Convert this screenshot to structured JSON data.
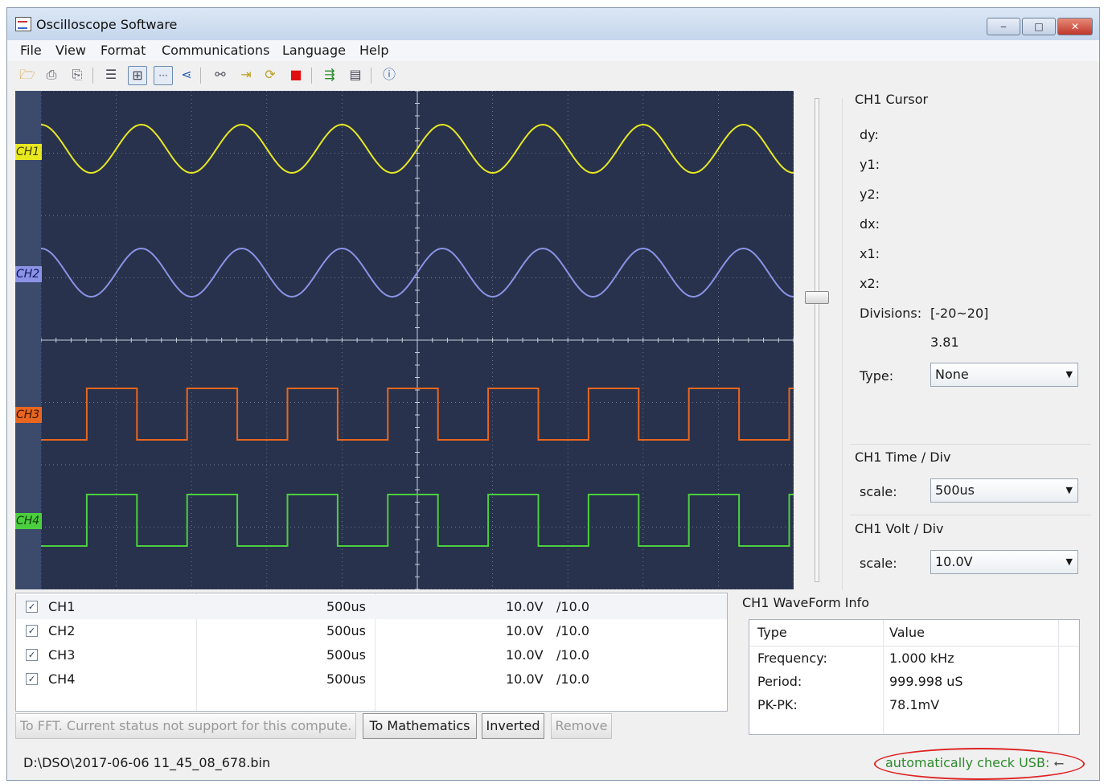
{
  "window": {
    "title": "Oscilloscope Software",
    "controls": {
      "minimize": "‒",
      "maximize": "□",
      "close": "✕"
    }
  },
  "menu": [
    "File",
    "View",
    "Format",
    "Communications",
    "Language",
    "Help"
  ],
  "toolbar_icons": [
    "open-icon",
    "print-icon",
    "print-preview-icon",
    "list-icon",
    "grid-icon",
    "dots-icon",
    "cursor-icon",
    "connect-icon",
    "import-icon",
    "run-icon",
    "stop-icon",
    "export-icon",
    "display-icon",
    "help-icon"
  ],
  "scope": {
    "labels": [
      "CH1",
      "CH2",
      "CH3",
      "CH4"
    ],
    "colors": {
      "ch1": "#e8e821",
      "ch2": "#8a93e6",
      "ch3": "#e8661f",
      "ch4": "#4ccf3e",
      "background": "#28324c",
      "grid": "#8892a8"
    },
    "waveforms": [
      {
        "channel": "CH1",
        "shape": "sine",
        "cycles": 7.5
      },
      {
        "channel": "CH2",
        "shape": "sine",
        "cycles": 7.5
      },
      {
        "channel": "CH3",
        "shape": "square",
        "cycles": 7.5
      },
      {
        "channel": "CH4",
        "shape": "square",
        "cycles": 7.5
      }
    ]
  },
  "cursor": {
    "title": "CH1 Cursor",
    "dy": "dy:",
    "y1": "y1:",
    "y2": "y2:",
    "dx": "dx:",
    "x1": "x1:",
    "x2": "x2:",
    "divisions_label": "Divisions:",
    "divisions_range": "[-20~20]",
    "divisions_value": "3.81",
    "type_label": "Type:",
    "type_value": "None"
  },
  "time_div": {
    "title": "CH1 Time / Div",
    "scale_label": "scale:",
    "value": "500us"
  },
  "volt_div": {
    "title": "CH1 Volt / Div",
    "scale_label": "scale:",
    "value": "10.0V"
  },
  "channels": [
    {
      "name": "CH1",
      "time": "500us",
      "volt": "10.0V",
      "probe": "/10.0"
    },
    {
      "name": "CH2",
      "time": "500us",
      "volt": "10.0V",
      "probe": "/10.0"
    },
    {
      "name": "CH3",
      "time": "500us",
      "volt": "10.0V",
      "probe": "/10.0"
    },
    {
      "name": "CH4",
      "time": "500us",
      "volt": "10.0V",
      "probe": "/10.0"
    }
  ],
  "buttons": {
    "fft": "To FFT. Current status not support for this compute.",
    "math": "To Mathematics",
    "inverted": "Inverted",
    "remove": "Remove"
  },
  "waveform_info": {
    "title": "CH1 WaveForm Info",
    "headers": [
      "Type",
      "Value"
    ],
    "rows": [
      {
        "type": "Frequency:",
        "value": "1.000 kHz"
      },
      {
        "type": "Period:",
        "value": "999.998 uS"
      },
      {
        "type": "PK-PK:",
        "value": "78.1mV"
      }
    ]
  },
  "status": {
    "path": "D:\\DSO\\2017-06-06 11_45_08_678.bin",
    "usb": "automatically check USB:"
  }
}
